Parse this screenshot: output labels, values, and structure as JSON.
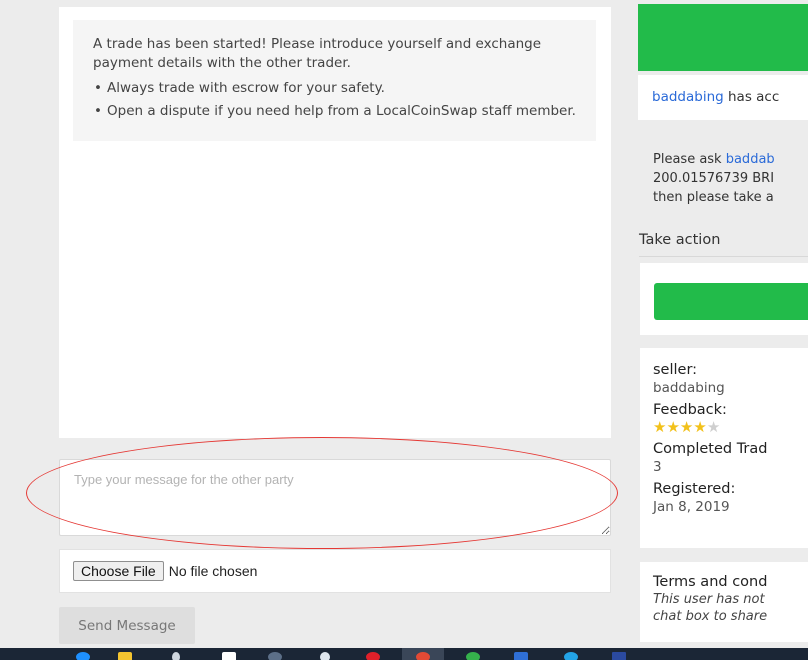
{
  "notice": {
    "intro": "A trade has been started! Please introduce yourself and exchange payment details with the other trader.",
    "tips": [
      "Always trade with escrow for your safety.",
      "Open a dispute if you need help from a LocalCoinSwap staff member."
    ]
  },
  "message": {
    "placeholder": "Type your message for the other party"
  },
  "file_upload": {
    "button_label": "Choose File",
    "status": "No file chosen"
  },
  "send_button": "Send Message",
  "status_panel": {
    "user_link": "baddabing",
    "accept_text": " has acc",
    "ask_prefix": "Please ask ",
    "ask_link": "baddab",
    "ask_line2": "200.01576739 BRI",
    "ask_line3": "then please take a"
  },
  "take_action": {
    "heading": "Take action"
  },
  "seller": {
    "seller_label": "seller:",
    "seller_name": "baddabing",
    "feedback_label": "Feedback:",
    "rating": 4,
    "rating_max": 5,
    "completed_label": "Completed Trad",
    "completed_value": "3",
    "registered_label": "Registered:",
    "registered_value": "Jan 8, 2019"
  },
  "terms": {
    "title": "Terms and cond",
    "line1": "This user has not",
    "line2": "chat box to share"
  },
  "colors": {
    "accent_green": "#22bb4a",
    "link_blue": "#2a6ad8",
    "annotation_red": "#e53935",
    "star_gold": "#f2c11b"
  },
  "taskbar": {
    "icons": [
      "windows-icon",
      "folder-icon",
      "pin-icon",
      "gmail-icon",
      "app-icon",
      "dropbox-icon",
      "opera-icon",
      "chrome-active-icon",
      "chrome-icon",
      "files-icon",
      "app-icon",
      "monitor-icon"
    ]
  }
}
